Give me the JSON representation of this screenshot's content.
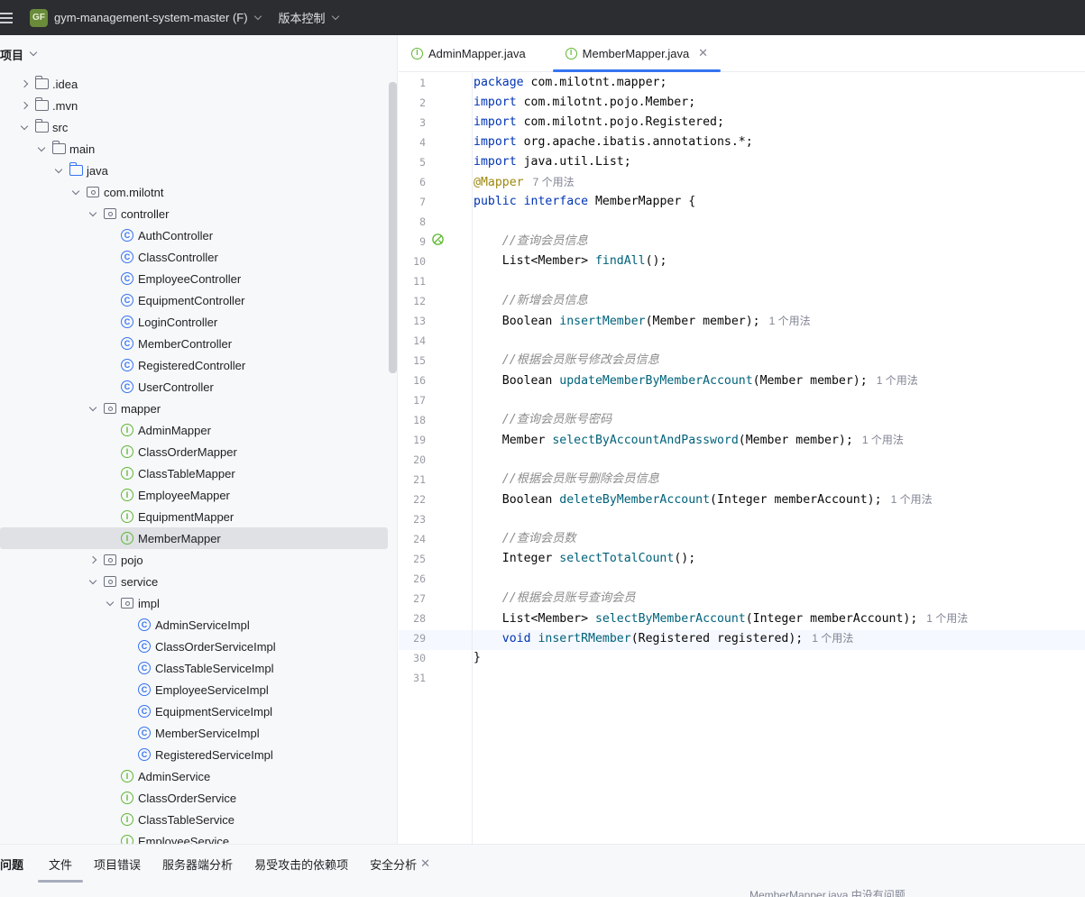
{
  "titlebar": {
    "project_badge": "GF",
    "project_name": "gym-management-system-master (F)",
    "vcs_label": "版本控制"
  },
  "project_panel": {
    "title": "项目",
    "tree": [
      {
        "label": ".idea",
        "depth": 1,
        "arrow": "right",
        "icon": "folder"
      },
      {
        "label": ".mvn",
        "depth": 1,
        "arrow": "right",
        "icon": "folder"
      },
      {
        "label": "src",
        "depth": 1,
        "arrow": "down",
        "icon": "folder"
      },
      {
        "label": "main",
        "depth": 2,
        "arrow": "down",
        "icon": "folder"
      },
      {
        "label": "java",
        "depth": 3,
        "arrow": "down",
        "icon": "folder-blue"
      },
      {
        "label": "com.milotnt",
        "depth": 4,
        "arrow": "down",
        "icon": "package"
      },
      {
        "label": "controller",
        "depth": 5,
        "arrow": "down",
        "icon": "package"
      },
      {
        "label": "AuthController",
        "depth": 6,
        "arrow": "none",
        "icon": "class"
      },
      {
        "label": "ClassController",
        "depth": 6,
        "arrow": "none",
        "icon": "class"
      },
      {
        "label": "EmployeeController",
        "depth": 6,
        "arrow": "none",
        "icon": "class"
      },
      {
        "label": "EquipmentController",
        "depth": 6,
        "arrow": "none",
        "icon": "class"
      },
      {
        "label": "LoginController",
        "depth": 6,
        "arrow": "none",
        "icon": "class"
      },
      {
        "label": "MemberController",
        "depth": 6,
        "arrow": "none",
        "icon": "class"
      },
      {
        "label": "RegisteredController",
        "depth": 6,
        "arrow": "none",
        "icon": "class"
      },
      {
        "label": "UserController",
        "depth": 6,
        "arrow": "none",
        "icon": "class"
      },
      {
        "label": "mapper",
        "depth": 5,
        "arrow": "down",
        "icon": "package"
      },
      {
        "label": "AdminMapper",
        "depth": 6,
        "arrow": "none",
        "icon": "interface"
      },
      {
        "label": "ClassOrderMapper",
        "depth": 6,
        "arrow": "none",
        "icon": "interface"
      },
      {
        "label": "ClassTableMapper",
        "depth": 6,
        "arrow": "none",
        "icon": "interface"
      },
      {
        "label": "EmployeeMapper",
        "depth": 6,
        "arrow": "none",
        "icon": "interface"
      },
      {
        "label": "EquipmentMapper",
        "depth": 6,
        "arrow": "none",
        "icon": "interface"
      },
      {
        "label": "MemberMapper",
        "depth": 6,
        "arrow": "none",
        "icon": "interface",
        "selected": true
      },
      {
        "label": "pojo",
        "depth": 5,
        "arrow": "right",
        "icon": "package"
      },
      {
        "label": "service",
        "depth": 5,
        "arrow": "down",
        "icon": "package"
      },
      {
        "label": "impl",
        "depth": 6,
        "arrow": "down",
        "icon": "package"
      },
      {
        "label": "AdminServiceImpl",
        "depth": 7,
        "arrow": "none",
        "icon": "class"
      },
      {
        "label": "ClassOrderServiceImpl",
        "depth": 7,
        "arrow": "none",
        "icon": "class"
      },
      {
        "label": "ClassTableServiceImpl",
        "depth": 7,
        "arrow": "none",
        "icon": "class"
      },
      {
        "label": "EmployeeServiceImpl",
        "depth": 7,
        "arrow": "none",
        "icon": "class"
      },
      {
        "label": "EquipmentServiceImpl",
        "depth": 7,
        "arrow": "none",
        "icon": "class"
      },
      {
        "label": "MemberServiceImpl",
        "depth": 7,
        "arrow": "none",
        "icon": "class"
      },
      {
        "label": "RegisteredServiceImpl",
        "depth": 7,
        "arrow": "none",
        "icon": "class"
      },
      {
        "label": "AdminService",
        "depth": 6,
        "arrow": "none",
        "icon": "interface"
      },
      {
        "label": "ClassOrderService",
        "depth": 6,
        "arrow": "none",
        "icon": "interface"
      },
      {
        "label": "ClassTableService",
        "depth": 6,
        "arrow": "none",
        "icon": "interface"
      },
      {
        "label": "EmployeeService",
        "depth": 6,
        "arrow": "none",
        "icon": "interface"
      }
    ]
  },
  "editor": {
    "tabs": [
      {
        "label": "AdminMapper.java",
        "active": false
      },
      {
        "label": "MemberMapper.java",
        "active": true
      }
    ],
    "lines": [
      [
        {
          "t": "package ",
          "c": "kw"
        },
        {
          "t": "com.milotnt.mapper;",
          "c": ""
        }
      ],
      [
        {
          "t": "import ",
          "c": "kw"
        },
        {
          "t": "com.milotnt.pojo.Member;",
          "c": ""
        }
      ],
      [
        {
          "t": "import ",
          "c": "kw"
        },
        {
          "t": "com.milotnt.pojo.Registered;",
          "c": ""
        }
      ],
      [
        {
          "t": "import ",
          "c": "kw"
        },
        {
          "t": "org.apache.ibatis.annotations.*;",
          "c": ""
        }
      ],
      [
        {
          "t": "import ",
          "c": "kw"
        },
        {
          "t": "java.util.List;",
          "c": ""
        }
      ],
      [
        {
          "t": "@Mapper",
          "c": "ann"
        },
        {
          "t": "7 个用法",
          "c": "hint"
        }
      ],
      [
        {
          "t": "public interface ",
          "c": "kw"
        },
        {
          "t": "MemberMapper {",
          "c": ""
        }
      ],
      [],
      [
        {
          "t": "    //查询会员信息",
          "c": "cmt"
        }
      ],
      [
        {
          "t": "    List<Member> ",
          "c": ""
        },
        {
          "t": "findAll",
          "c": "fn"
        },
        {
          "t": "();",
          "c": ""
        }
      ],
      [],
      [
        {
          "t": "    //新增会员信息",
          "c": "cmt"
        }
      ],
      [
        {
          "t": "    Boolean ",
          "c": ""
        },
        {
          "t": "insertMember",
          "c": "fn"
        },
        {
          "t": "(Member member);",
          "c": ""
        },
        {
          "t": "1 个用法",
          "c": "hint"
        }
      ],
      [],
      [
        {
          "t": "    //根据会员账号修改会员信息",
          "c": "cmt"
        }
      ],
      [
        {
          "t": "    Boolean ",
          "c": ""
        },
        {
          "t": "updateMemberByMemberAccount",
          "c": "fn"
        },
        {
          "t": "(Member member);",
          "c": ""
        },
        {
          "t": "1 个用法",
          "c": "hint"
        }
      ],
      [],
      [
        {
          "t": "    //查询会员账号密码",
          "c": "cmt"
        }
      ],
      [
        {
          "t": "    Member ",
          "c": ""
        },
        {
          "t": "selectByAccountAndPassword",
          "c": "fn"
        },
        {
          "t": "(Member member);",
          "c": ""
        },
        {
          "t": "1 个用法",
          "c": "hint"
        }
      ],
      [],
      [
        {
          "t": "    //根据会员账号删除会员信息",
          "c": "cmt"
        }
      ],
      [
        {
          "t": "    Boolean ",
          "c": ""
        },
        {
          "t": "deleteByMemberAccount",
          "c": "fn"
        },
        {
          "t": "(Integer memberAccount);",
          "c": ""
        },
        {
          "t": "1 个用法",
          "c": "hint"
        }
      ],
      [],
      [
        {
          "t": "    //查询会员数",
          "c": "cmt"
        }
      ],
      [
        {
          "t": "    Integer ",
          "c": ""
        },
        {
          "t": "selectTotalCount",
          "c": "fn"
        },
        {
          "t": "();",
          "c": ""
        }
      ],
      [],
      [
        {
          "t": "    //根据会员账号查询会员",
          "c": "cmt"
        }
      ],
      [
        {
          "t": "    List<Member> ",
          "c": ""
        },
        {
          "t": "selectByMemberAccount",
          "c": "fn"
        },
        {
          "t": "(Integer memberAccount);",
          "c": ""
        },
        {
          "t": "1 个用法",
          "c": "hint"
        }
      ],
      [
        {
          "t": "    ",
          "c": ""
        },
        {
          "t": "void ",
          "c": "kw"
        },
        {
          "t": "insertRMember",
          "c": "fn"
        },
        {
          "t": "(Registered registered);",
          "c": ""
        },
        {
          "t": "1 个用法",
          "c": "hint"
        }
      ],
      [
        {
          "t": "}",
          "c": ""
        }
      ],
      []
    ]
  },
  "bottom_panel": {
    "title": "问题",
    "tabs": [
      {
        "label": "文件",
        "active": true
      },
      {
        "label": "项目错误",
        "active": false
      },
      {
        "label": "服务器端分析",
        "active": false
      },
      {
        "label": "易受攻击的依赖项",
        "active": false
      },
      {
        "label": "安全分析",
        "active": false,
        "closable": true
      }
    ],
    "status": "MemberMapper.java 中没有问题"
  }
}
